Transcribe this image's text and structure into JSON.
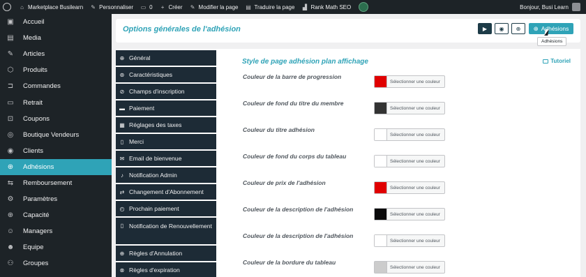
{
  "adminbar": {
    "site_name": "Marketplace Busilearn",
    "customize": "Personnaliser",
    "comments": "0",
    "new": "Créer",
    "edit_page": "Modifier la page",
    "translate": "Traduire la page",
    "seo": "Rank Math SEO",
    "greeting": "Bonjour, Busi Learn"
  },
  "menu": {
    "items": [
      {
        "label": "Accueil",
        "icon": "dashboard-icon",
        "glyph": "▣"
      },
      {
        "label": "Media",
        "icon": "media-icon",
        "glyph": "▤"
      },
      {
        "label": "Articles",
        "icon": "pin-icon",
        "glyph": "✎"
      },
      {
        "label": "Produits",
        "icon": "box-icon",
        "glyph": "⬡"
      },
      {
        "label": "Commandes",
        "icon": "cart-icon",
        "glyph": "⊐"
      },
      {
        "label": "Retrait",
        "icon": "withdraw-icon",
        "glyph": "▭"
      },
      {
        "label": "Coupons",
        "icon": "gift-icon",
        "glyph": "⊡"
      },
      {
        "label": "Boutique Vendeurs",
        "icon": "user-icon",
        "glyph": "◎"
      },
      {
        "label": "Clients",
        "icon": "client-icon",
        "glyph": "◉"
      },
      {
        "label": "Adhésions",
        "icon": "user-plus-icon",
        "glyph": "⊕"
      },
      {
        "label": "Remboursement",
        "icon": "refund-icon",
        "glyph": "⇆"
      },
      {
        "label": "Paramètres",
        "icon": "gears-icon",
        "glyph": "⚙"
      },
      {
        "label": "Capacité",
        "icon": "capacity-icon",
        "glyph": "⊕"
      },
      {
        "label": "Managers",
        "icon": "managers-icon",
        "glyph": "☺"
      },
      {
        "label": "Equipe",
        "icon": "team-icon",
        "glyph": "☻"
      },
      {
        "label": "Groupes",
        "icon": "groups-icon",
        "glyph": "⚇"
      }
    ]
  },
  "header": {
    "title": "Options générales de l'adhésion",
    "main_button": "Adhésions",
    "tooltip": "Adhésions"
  },
  "subnav": {
    "items": [
      {
        "label": "Général",
        "glyph": "⊕"
      },
      {
        "label": "Caractéristiques",
        "glyph": "⊛"
      },
      {
        "label": "Champs d'inscription",
        "glyph": "⊘"
      },
      {
        "label": "Paiement",
        "glyph": "▬"
      },
      {
        "label": "Réglages des taxes",
        "glyph": "▦"
      },
      {
        "label": "Merci",
        "glyph": "▯"
      },
      {
        "label": "Email de bienvenue",
        "glyph": "✉"
      },
      {
        "label": "Notification Admin",
        "glyph": "♪"
      },
      {
        "label": "Changement d'Abonnement",
        "glyph": "⇄"
      },
      {
        "label": "Prochain paiement",
        "glyph": "◴"
      },
      {
        "label": "Notification de Renouvellement",
        "glyph": "▯"
      },
      {
        "label": "Règles d'Annulation",
        "glyph": "⊕"
      },
      {
        "label": "Règles d'expiration",
        "glyph": "⊗"
      }
    ]
  },
  "section": {
    "title": "Style de page adhésion plan affichage",
    "tutorial": "Tutoriel",
    "picker_label": "Sélectionner une couleur",
    "fields": [
      {
        "label": "Couleur de la barre de progression",
        "color": "#e00000"
      },
      {
        "label": "Couleur de fond du titre du membre",
        "color": "#333333"
      },
      {
        "label": "Couleur du titre adhésion",
        "color": "#ffffff"
      },
      {
        "label": "Couleur de fond du corps du tableau",
        "color": "#ffffff"
      },
      {
        "label": "Couleur de prix de l'adhésion",
        "color": "#e00000"
      },
      {
        "label": "Couleur de la description de l'adhésion",
        "color": "#0a0a0a"
      },
      {
        "label": "Couleur de la description de l'adhésion",
        "color": "#ffffff"
      },
      {
        "label": "Couleur de la bordure du tableau",
        "color": "#cccccc"
      }
    ]
  }
}
